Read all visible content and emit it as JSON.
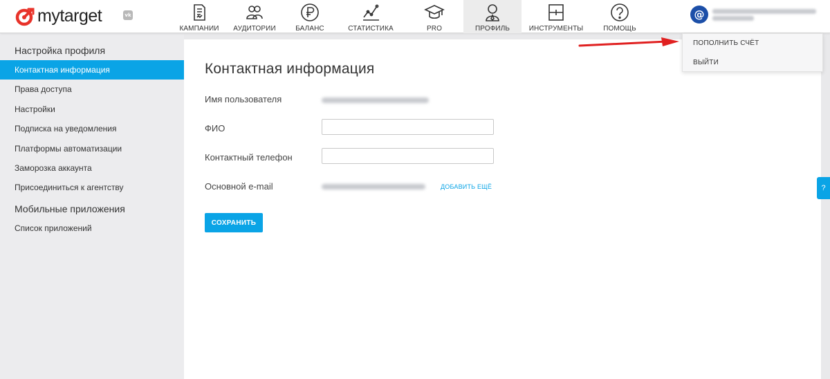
{
  "brand": {
    "name": "mytarget",
    "vk_badge": "vk",
    "accent": "#0aa4e6",
    "logo_red": "#e8332a"
  },
  "nav": [
    {
      "label": "КАМПАНИИ",
      "icon": "campaigns-icon"
    },
    {
      "label": "АУДИТОРИИ",
      "icon": "audiences-icon"
    },
    {
      "label": "БАЛАНС",
      "icon": "ruble-icon"
    },
    {
      "label": "СТАТИСТИКА",
      "icon": "statistics-icon"
    },
    {
      "label": "PRO",
      "icon": "graduation-cap-icon"
    },
    {
      "label": "ПРОФИЛЬ",
      "icon": "profile-icon",
      "active": true
    },
    {
      "label": "ИНСТРУМЕНТЫ",
      "icon": "tools-icon"
    },
    {
      "label": "ПОМОЩЬ",
      "icon": "help-icon"
    }
  ],
  "user": {
    "avatar_glyph": "@"
  },
  "dropdown": {
    "items": [
      "ПОПОЛНИТЬ СЧЁТ",
      "ВЫЙТИ"
    ]
  },
  "sidebar": {
    "section1": "Настройка профиля",
    "items1": [
      "Контактная информация",
      "Права доступа",
      "Настройки",
      "Подписка на уведомления",
      "Платформы автоматизации",
      "Заморозка аккаунта",
      "Присоединиться к агентству"
    ],
    "section2": "Мобильные приложения",
    "items2": [
      "Список приложений"
    ]
  },
  "main": {
    "title": "Контактная информация",
    "labels": {
      "username": "Имя пользователя",
      "fio": "ФИО",
      "phone": "Контактный телефон",
      "email": "Основной e-mail"
    },
    "fio_value": "",
    "phone_value": "",
    "add_more": "ДОБАВИТЬ ЕЩЁ",
    "save": "СОХРАНИТЬ"
  },
  "help_tab": "?"
}
